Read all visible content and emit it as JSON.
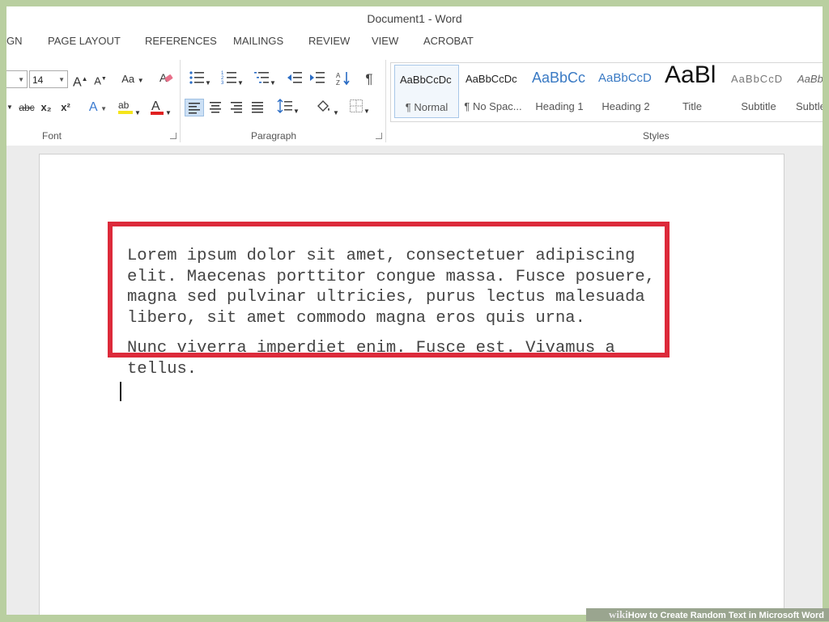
{
  "window": {
    "title": "Document1 - Word"
  },
  "tabs": [
    {
      "label": "GN"
    },
    {
      "label": "PAGE LAYOUT"
    },
    {
      "label": "REFERENCES"
    },
    {
      "label": "MAILINGS"
    },
    {
      "label": "REVIEW"
    },
    {
      "label": "VIEW"
    },
    {
      "label": "ACROBAT"
    }
  ],
  "ribbon": {
    "font": {
      "label": "Font",
      "size": "14",
      "grow_label": "A",
      "shrink_label": "A",
      "case_label": "Aa",
      "strike_label": "abc",
      "subscript_label": "x₂",
      "superscript_label": "x²",
      "text_effects_label": "A",
      "font_color_label": "A",
      "colors": {
        "highlight": "#f5e51b",
        "font_color": "#e02020"
      }
    },
    "paragraph": {
      "label": "Paragraph"
    },
    "styles": {
      "label": "Styles",
      "items": [
        {
          "preview": "AaBbCcDc",
          "name": "¶ Normal"
        },
        {
          "preview": "AaBbCcDc",
          "name": "¶ No Spac..."
        },
        {
          "preview": "AaBbCc",
          "name": "Heading 1"
        },
        {
          "preview": "AaBbCcD",
          "name": "Heading 2"
        },
        {
          "preview": "AaBl",
          "name": "Title"
        },
        {
          "preview": "AaBbCcD",
          "name": "Subtitle"
        },
        {
          "preview": "AaBb",
          "name": "Subtle"
        }
      ]
    }
  },
  "document": {
    "paragraphs": [
      "Lorem ipsum dolor sit amet, consectetuer adipiscing elit. Maecenas porttitor congue massa. Fusce posuere, magna sed pulvinar ultricies, purus lectus malesuada libero, sit amet commodo magna eros quis urna.",
      "Nunc viverra imperdiet enim. Fusce est. Vivamus a tellus."
    ],
    "highlight_color": "#dc2a3a"
  },
  "watermark": {
    "brand": "wiki",
    "text": "How to Create Random Text in Microsoft Word"
  }
}
